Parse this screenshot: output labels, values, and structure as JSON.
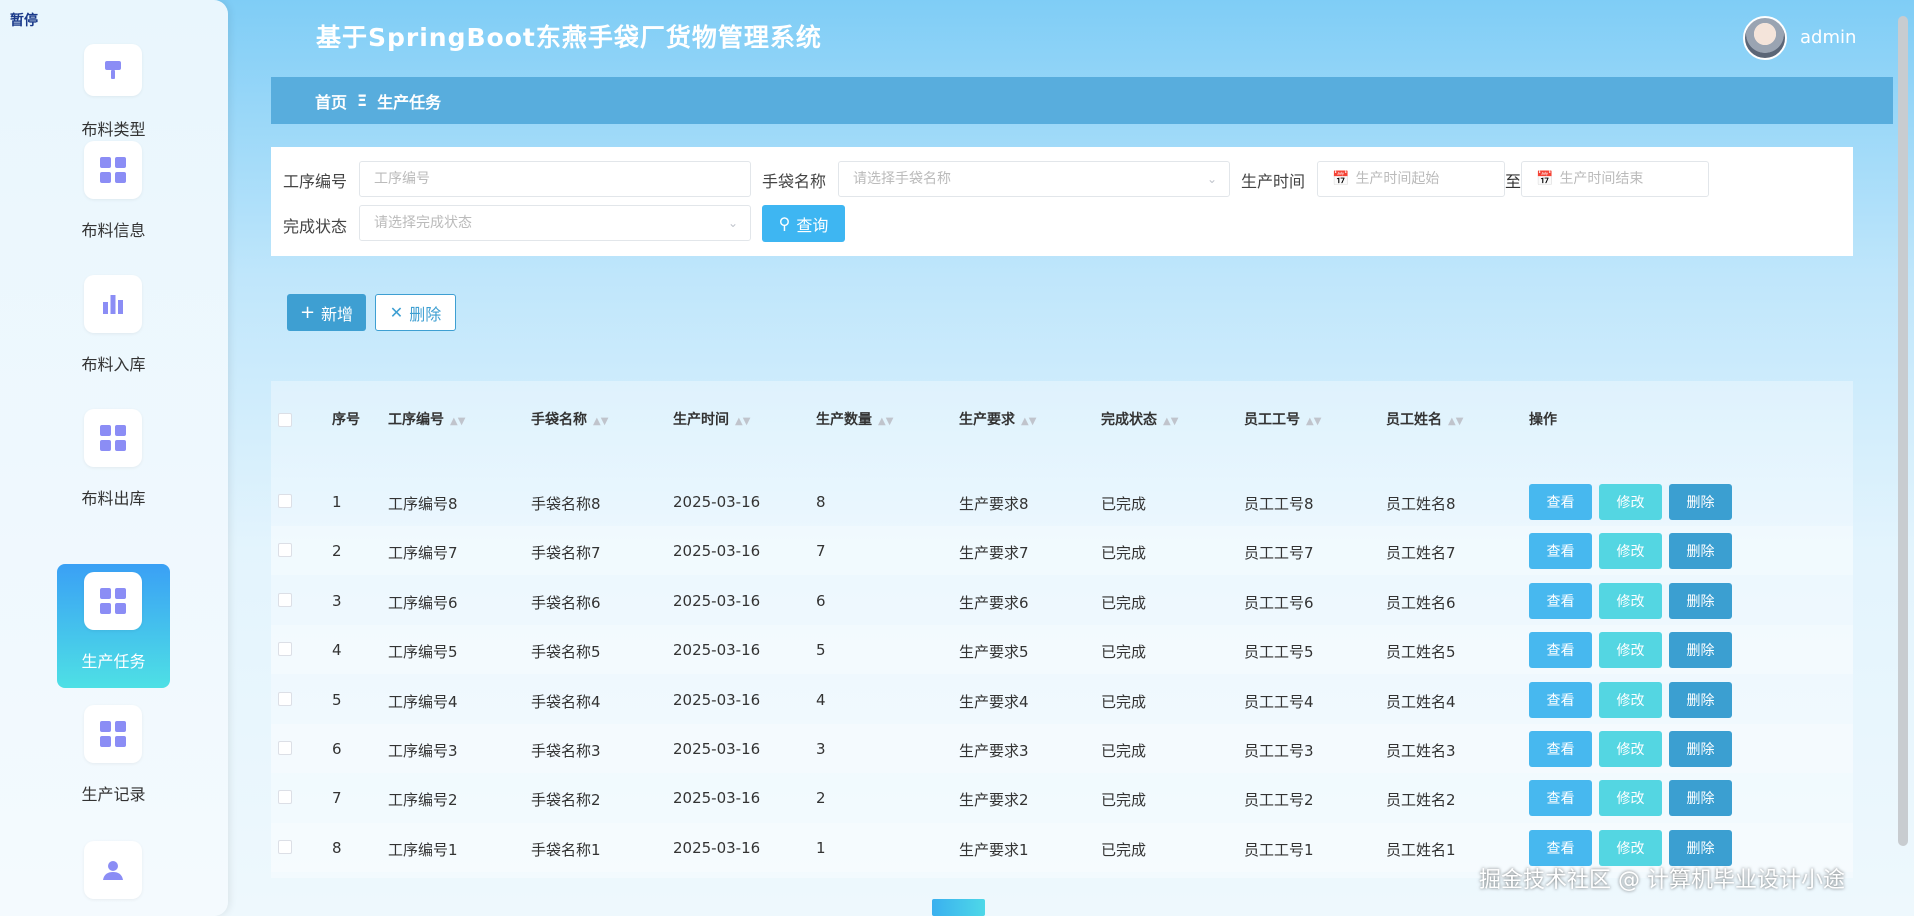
{
  "pause_label": "暂停",
  "app": {
    "title": "基于SpringBoot东燕手袋厂货物管理系统",
    "user": "admin"
  },
  "sidebar": {
    "items": [
      {
        "label": "布料类型",
        "icon": "paint-brush-icon"
      },
      {
        "label": "布料信息",
        "icon": "grid-icon"
      },
      {
        "label": "布料入库",
        "icon": "bar-chart-icon"
      },
      {
        "label": "布料出库",
        "icon": "grid-icon"
      },
      {
        "label": "生产任务",
        "icon": "grid-icon",
        "active": true
      },
      {
        "label": "生产记录",
        "icon": "grid-icon"
      },
      {
        "label": "",
        "icon": "user-icon"
      }
    ]
  },
  "breadcrumb": {
    "home": "首页",
    "separator": "Ξ",
    "current": "生产任务"
  },
  "search": {
    "process_no_label": "工序编号",
    "process_no_placeholder": "工序编号",
    "bag_name_label": "手袋名称",
    "bag_name_placeholder": "请选择手袋名称",
    "time_label": "生产时间",
    "time_start_placeholder": "生产时间起始",
    "time_to": "至",
    "time_end_placeholder": "生产时间结束",
    "status_label": "完成状态",
    "status_placeholder": "请选择完成状态",
    "query_button": "查询"
  },
  "toolbar": {
    "add_button": "新增",
    "delete_button": "删除"
  },
  "table": {
    "columns": [
      "序号",
      "工序编号",
      "手袋名称",
      "生产时间",
      "生产数量",
      "生产要求",
      "完成状态",
      "员工工号",
      "员工姓名",
      "操作"
    ],
    "actions": {
      "view": "查看",
      "edit": "修改",
      "delete": "删除"
    },
    "rows": [
      [
        "1",
        "工序编号8",
        "手袋名称8",
        "2025-03-16",
        "8",
        "生产要求8",
        "已完成",
        "员工工号8",
        "员工姓名8"
      ],
      [
        "2",
        "工序编号7",
        "手袋名称7",
        "2025-03-16",
        "7",
        "生产要求7",
        "已完成",
        "员工工号7",
        "员工姓名7"
      ],
      [
        "3",
        "工序编号6",
        "手袋名称6",
        "2025-03-16",
        "6",
        "生产要求6",
        "已完成",
        "员工工号6",
        "员工姓名6"
      ],
      [
        "4",
        "工序编号5",
        "手袋名称5",
        "2025-03-16",
        "5",
        "生产要求5",
        "已完成",
        "员工工号5",
        "员工姓名5"
      ],
      [
        "5",
        "工序编号4",
        "手袋名称4",
        "2025-03-16",
        "4",
        "生产要求4",
        "已完成",
        "员工工号4",
        "员工姓名4"
      ],
      [
        "6",
        "工序编号3",
        "手袋名称3",
        "2025-03-16",
        "3",
        "生产要求3",
        "已完成",
        "员工工号3",
        "员工姓名3"
      ],
      [
        "7",
        "工序编号2",
        "手袋名称2",
        "2025-03-16",
        "2",
        "生产要求2",
        "已完成",
        "员工工号2",
        "员工姓名2"
      ],
      [
        "8",
        "工序编号1",
        "手袋名称1",
        "2025-03-16",
        "1",
        "生产要求1",
        "已完成",
        "员工工号1",
        "员工姓名1"
      ]
    ]
  },
  "watermark": "掘金技术社区 @ 计算机毕业设计小途"
}
